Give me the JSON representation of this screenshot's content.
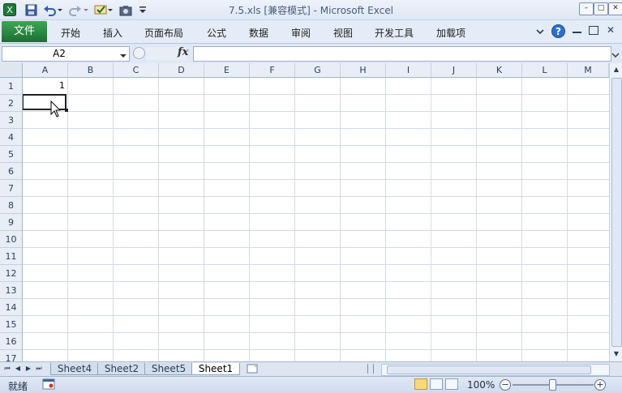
{
  "window": {
    "title": "7.5.xls  [兼容模式]  -  Microsoft Excel",
    "minimize": "–",
    "restore": "□",
    "close": "✕"
  },
  "quick_access": {
    "app_icon": "excel-icon",
    "save_icon": "save-icon",
    "undo_icon": "undo-icon",
    "redo_icon": "redo-icon",
    "spell_icon": "spellcheck-icon",
    "camera_icon": "camera-icon",
    "customize_icon": "customize-qat-icon"
  },
  "ribbon": {
    "file_tab": "文件",
    "tabs": [
      "开始",
      "插入",
      "页面布局",
      "公式",
      "数据",
      "审阅",
      "视图",
      "开发工具",
      "加载项"
    ]
  },
  "formula_bar": {
    "name_box": "A2",
    "fx_label": "fx",
    "formula_value": ""
  },
  "sheet": {
    "columns": [
      "A",
      "B",
      "C",
      "D",
      "E",
      "F",
      "G",
      "H",
      "I",
      "J",
      "K",
      "L",
      "M"
    ],
    "rows": [
      "1",
      "2",
      "3",
      "4",
      "5",
      "6",
      "7",
      "8",
      "9",
      "10",
      "11",
      "12",
      "13",
      "14",
      "15",
      "16",
      "17"
    ],
    "cells": {
      "A1": "1"
    }
  },
  "sheet_tabs": {
    "tabs": [
      "Sheet4",
      "Sheet2",
      "Sheet5",
      "Sheet1"
    ],
    "active": "Sheet1"
  },
  "status_bar": {
    "status": "就绪",
    "zoom": "100%"
  },
  "colors": {
    "file_tab": "#1d6e32",
    "header_bg": "#e9eef6",
    "grid_line": "#d4dbe5",
    "selection": "#217346"
  }
}
